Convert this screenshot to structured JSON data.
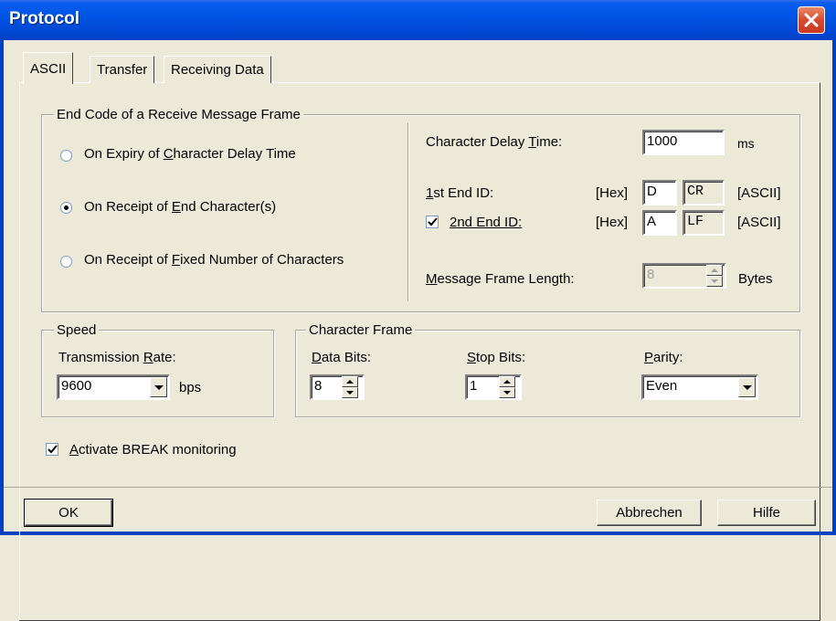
{
  "window": {
    "title": "Protocol"
  },
  "tabs": [
    {
      "label": "ASCII",
      "selected": true
    },
    {
      "label": "Transfer",
      "selected": false
    },
    {
      "label": "Receiving Data",
      "selected": false
    }
  ],
  "end_code": {
    "group_label": "End Code of a Receive Message Frame",
    "options": [
      {
        "pre": "On Expiry of ",
        "key": "C",
        "post": "haracter Delay Time",
        "selected": false
      },
      {
        "pre": "On Receipt of ",
        "key": "E",
        "post": "nd Character(s)",
        "selected": true
      },
      {
        "pre": "On Receipt of ",
        "key": "F",
        "post": "ixed Number of Characters",
        "selected": false
      }
    ],
    "delay_label_pre": "Character Delay ",
    "delay_label_key": "T",
    "delay_label_post": "ime:",
    "delay_value": "1000",
    "delay_unit": "ms",
    "end1_label_key": "1",
    "end1_label_post": "st End ID:",
    "end1_hex_label": "[Hex]",
    "end1_hex_value": "D",
    "end1_ascii_value": "CR",
    "end1_ascii_label": "[ASCII]",
    "end2_checked": true,
    "end2_label_key": "2",
    "end2_label_post": "nd End ID:",
    "end2_hex_label": "[Hex]",
    "end2_hex_value": "A",
    "end2_ascii_value": "LF",
    "end2_ascii_label": "[ASCII]",
    "length_label_key": "M",
    "length_label_post": "essage Frame Length:",
    "length_value": "8",
    "length_unit": "Bytes"
  },
  "speed": {
    "group_label": "Speed",
    "rate_label_pre": "Transmission ",
    "rate_label_key": "R",
    "rate_label_post": "ate:",
    "rate_value": "9600",
    "rate_unit": "bps"
  },
  "char_frame": {
    "group_label": "Character Frame",
    "data_bits_key": "D",
    "data_bits_post": "ata Bits:",
    "data_bits_value": "8",
    "stop_bits_key": "S",
    "stop_bits_post": "top Bits:",
    "stop_bits_value": "1",
    "parity_key": "P",
    "parity_post": "arity:",
    "parity_value": "Even"
  },
  "break_monitor": {
    "checked": true,
    "key": "A",
    "post": "ctivate BREAK monitoring"
  },
  "buttons": {
    "ok": "OK",
    "cancel": "Abbrechen",
    "help": "Hilfe"
  }
}
